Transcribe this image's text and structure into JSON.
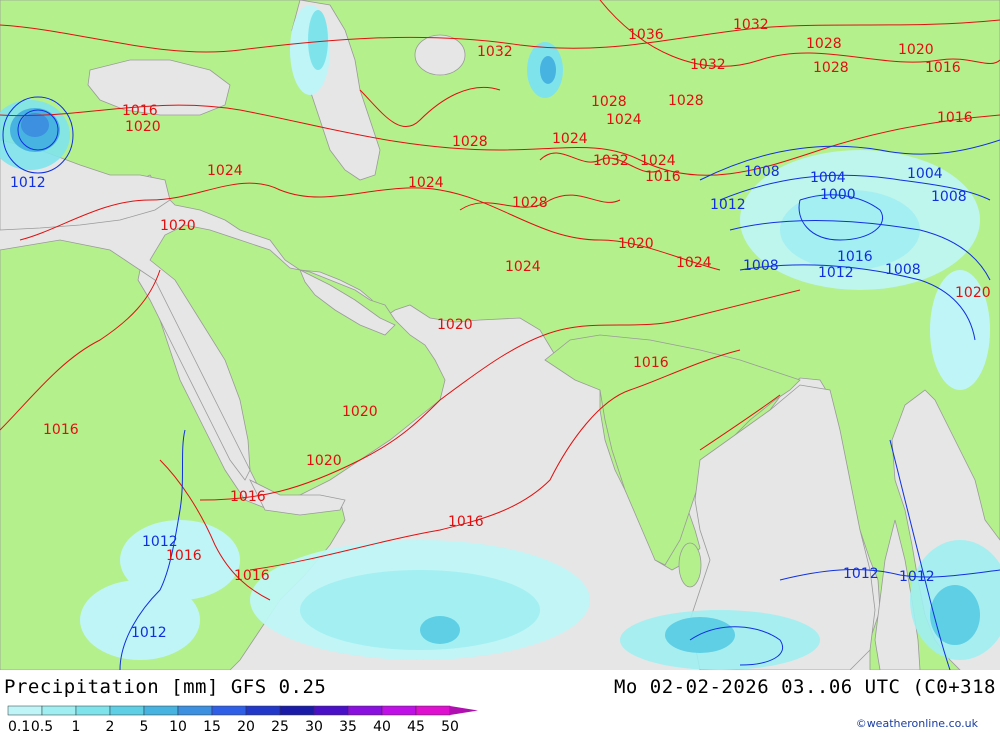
{
  "header": {
    "product_title": "Precipitation [mm]  GFS 0.25",
    "valid_time": "Mo 02-02-2026 03..06 UTC (C0+318"
  },
  "credit": "©weatheronline.co.uk",
  "legend": {
    "ticks": [
      "0.1",
      "0.5",
      "1",
      "2",
      "5",
      "10",
      "15",
      "20",
      "25",
      "30",
      "35",
      "40",
      "45",
      "50"
    ],
    "colors": [
      "#bff5f7",
      "#a0eef2",
      "#7fe3ec",
      "#5ecfe4",
      "#47b3e0",
      "#3d8fe0",
      "#2f5fe6",
      "#2238c8",
      "#1a1ca8",
      "#4a10c8",
      "#8a10e0",
      "#c010e8",
      "#e010d0",
      "#b010b0"
    ]
  },
  "map": {
    "colors": {
      "land": "#b4f08c",
      "sea": "#e6e6e6",
      "isobar_high": "#e01010",
      "isobar_low": "#1030e0",
      "border": "#9a9a9a"
    },
    "isobar_labels_red": [
      "1036",
      "1032",
      "1032",
      "1032",
      "1028",
      "1020",
      "1016",
      "1028",
      "1024",
      "1016",
      "1020",
      "1024",
      "1028",
      "1028",
      "1024",
      "1028",
      "1032",
      "1024",
      "1016",
      "1024",
      "1028",
      "1020",
      "1024",
      "1020",
      "1024",
      "1020",
      "1016",
      "1016",
      "1020",
      "1020",
      "1016",
      "1016",
      "1016",
      "1016",
      "1016",
      "1020"
    ],
    "isobar_labels_blue": [
      "1012",
      "1008",
      "1004",
      "1004",
      "1012",
      "1000",
      "1008",
      "1008",
      "1012",
      "1016",
      "1008",
      "1012",
      "1012",
      "1012",
      "1012"
    ]
  }
}
